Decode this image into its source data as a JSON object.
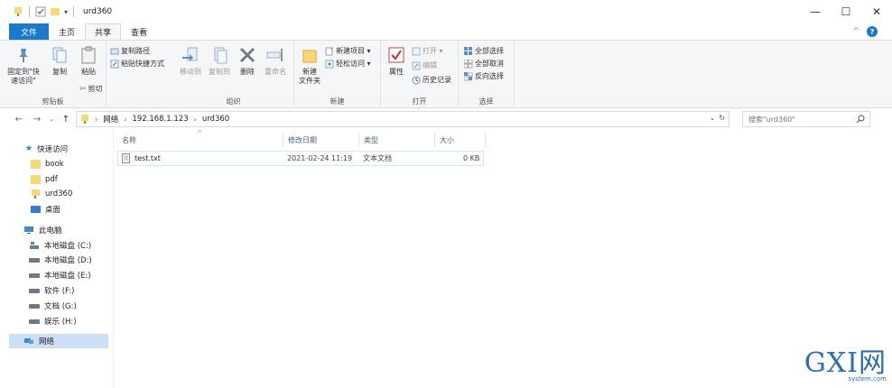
{
  "window": {
    "title": "urd360",
    "minimize": "—",
    "maximize": "☐",
    "close": "✕"
  },
  "tabs": {
    "file": "文件",
    "home": "主页",
    "share": "共享",
    "view": "查看"
  },
  "ribbon": {
    "clipboard": {
      "label": "剪贴板",
      "pin": "固定到\"快\n速访问\"",
      "copy": "复制",
      "paste": "粘贴",
      "copy_path": "复制路径",
      "paste_shortcut": "粘贴快捷方式",
      "cut": "剪切"
    },
    "organize": {
      "label": "组织",
      "move_to": "移动到",
      "copy_to": "复制到",
      "delete": "删除",
      "rename": "重命名"
    },
    "new": {
      "label": "新建",
      "new_folder": "新建\n文件夹",
      "new_item": "新建项目 ▾",
      "easy_access": "轻松访问 ▾"
    },
    "open": {
      "label": "打开",
      "properties": "属性",
      "open": "打开 ▾",
      "edit": "编辑",
      "history": "历史记录"
    },
    "select": {
      "label": "选择",
      "select_all": "全部选择",
      "select_none": "全部取消",
      "invert": "反向选择"
    }
  },
  "address": {
    "crumbs": [
      "网络",
      "192.168.1.123",
      "urd360"
    ],
    "search_placeholder": "搜索\"urd360\""
  },
  "navpane": {
    "quick_access": "快速访问",
    "quick_items": [
      "book",
      "pdf",
      "urd360",
      "桌面"
    ],
    "this_pc": "此电脑",
    "drives": [
      "本地磁盘 (C:)",
      "本地磁盘 (D:)",
      "本地磁盘 (E:)",
      "软件 (F:)",
      "文档 (G:)",
      "娱乐 (H:)"
    ],
    "network": "网络"
  },
  "columns": {
    "name": "名称",
    "modified": "修改日期",
    "type": "类型",
    "size": "大小"
  },
  "files": [
    {
      "name": "test.txt",
      "modified": "2021-02-24 11:19",
      "type": "文本文档",
      "size": "0 KB"
    }
  ],
  "watermark": {
    "main": "GXI网",
    "sub": "system.com"
  },
  "colors": {
    "accent": "#1979ca",
    "folder": "#f8d775",
    "ribbon_bg": "#f5f6f7"
  }
}
